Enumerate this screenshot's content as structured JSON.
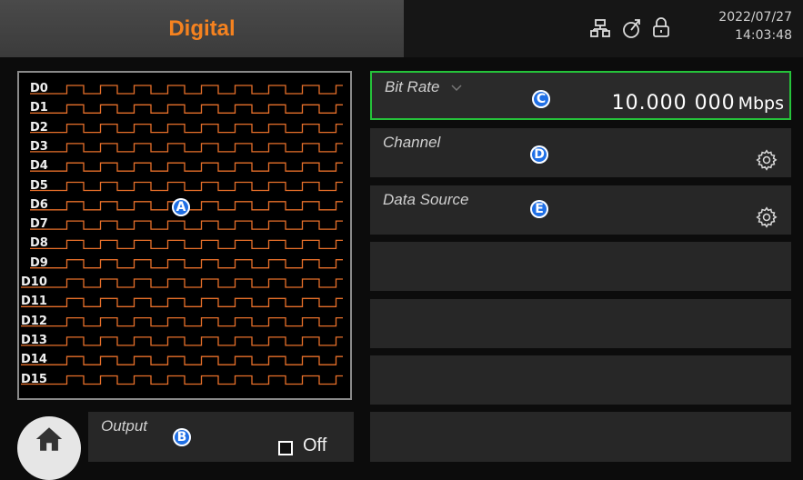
{
  "header": {
    "title": "Digital",
    "date": "2022/07/27",
    "time": "14:03:48",
    "icons": [
      "network-icon",
      "usb-icon",
      "lock-icon"
    ]
  },
  "waveform": {
    "channels": [
      "D0",
      "D1",
      "D2",
      "D3",
      "D4",
      "D5",
      "D6",
      "D7",
      "D8",
      "D9",
      "D10",
      "D11",
      "D12",
      "D13",
      "D14",
      "D15"
    ],
    "trace_color": "#e8702a",
    "callout": "A"
  },
  "output": {
    "label": "Output",
    "callout": "B",
    "state": "Off",
    "checked": false
  },
  "panels": {
    "bit_rate": {
      "label": "Bit Rate",
      "callout": "C",
      "value": "10.000 000",
      "unit": "Mbps"
    },
    "channel": {
      "label": "Channel",
      "callout": "D"
    },
    "data_source": {
      "label": "Data Source",
      "callout": "E"
    }
  },
  "colors": {
    "accent": "#f5821f",
    "selection": "#25c33a",
    "callout": "#1f6fe5"
  }
}
